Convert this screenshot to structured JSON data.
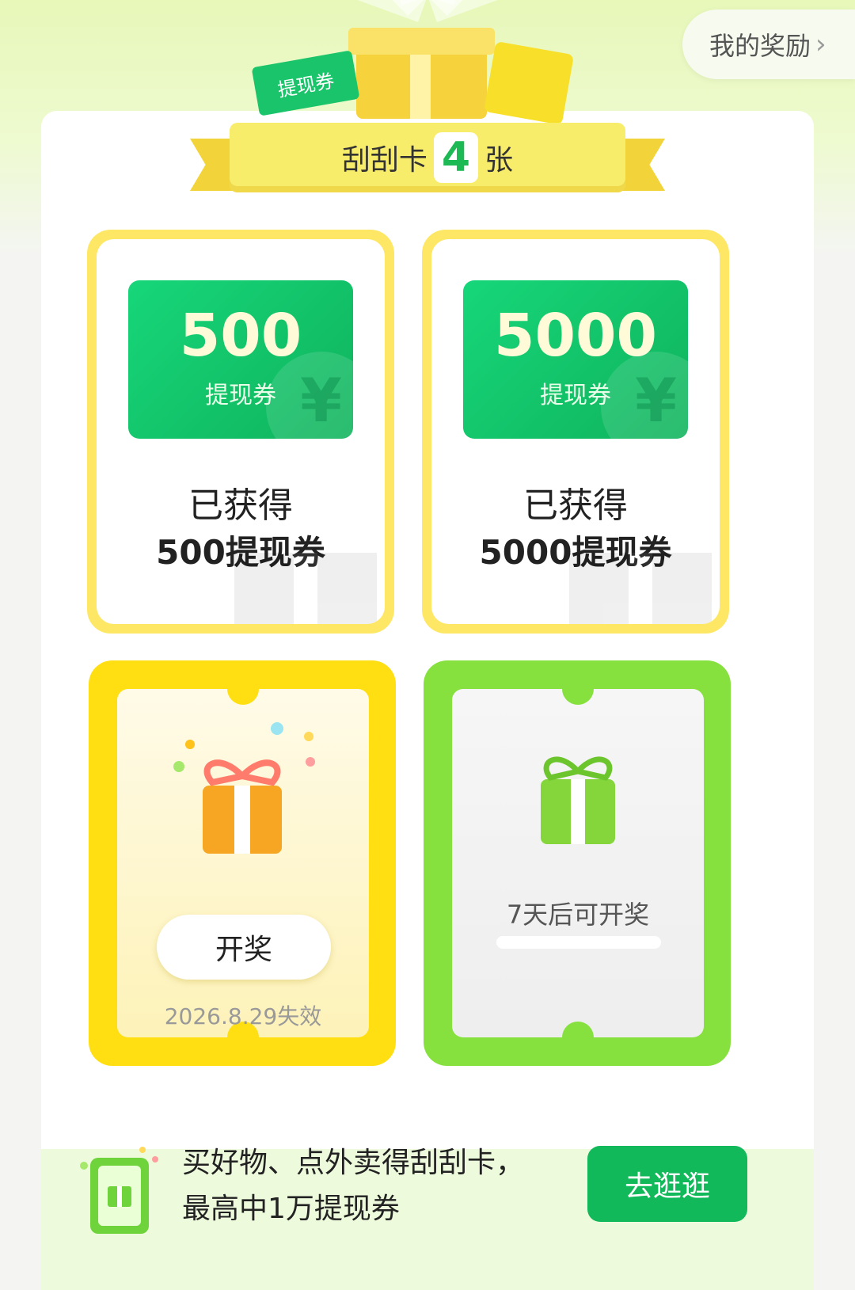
{
  "header": {
    "my_rewards_label": "我的奖励",
    "chevron_icon": "chevron-right-icon"
  },
  "banner": {
    "voucher_tag": "提现券",
    "prefix": "刮刮卡",
    "count": "4",
    "suffix": "张"
  },
  "cards": {
    "won": [
      {
        "amount": "500",
        "voucher_label": "提现券",
        "line1": "已获得",
        "line2": "500提现券"
      },
      {
        "amount": "5000",
        "voucher_label": "提现券",
        "line1": "已获得",
        "line2": "5000提现券"
      }
    ],
    "open": {
      "button": "开奖",
      "expire": "2026.8.29失效"
    },
    "locked": {
      "text": "7天后可开奖"
    }
  },
  "promo": {
    "line1": "买好物、点外卖得刮刮卡，",
    "line2": "最高中1万提现券",
    "button": "去逛逛"
  },
  "colors": {
    "brand_green": "#11b95a",
    "card_yellow": "#ffdf12",
    "card_green": "#86e13e"
  }
}
